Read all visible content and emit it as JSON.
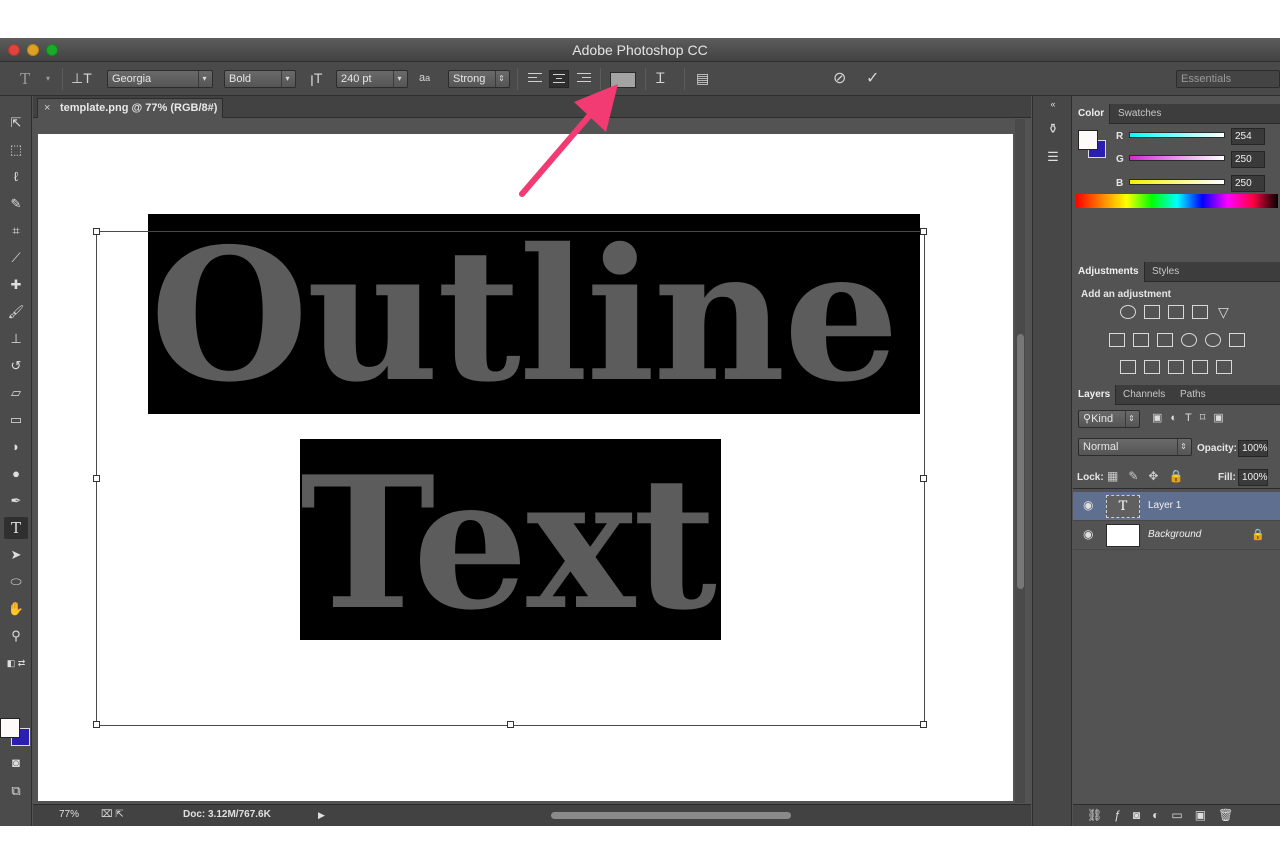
{
  "window": {
    "title": "Adobe Photoshop CC"
  },
  "options_bar": {
    "font_family": "Georgia",
    "font_style": "Bold",
    "font_size": "240 pt",
    "antialias_icon_text": "a",
    "antialias_icon_text2": "a",
    "antialias": "Strong",
    "text_color": "#a3a3a3",
    "workspace": "Essentials"
  },
  "document": {
    "tab_title": "template.png @ 77% (RGB/8#)",
    "tab_close": "×",
    "canvas_text_line1": "Outline",
    "canvas_text_line2": "Text"
  },
  "status_bar": {
    "zoom": "77%",
    "doc_info": "Doc: 3.12M/767.6K"
  },
  "color_panel": {
    "tabs": [
      "Color",
      "Swatches"
    ],
    "channels": [
      {
        "label": "R",
        "value": "254"
      },
      {
        "label": "G",
        "value": "250"
      },
      {
        "label": "B",
        "value": "250"
      }
    ],
    "foreground": "#fefafa",
    "background": "#2a1fb0"
  },
  "adjustments_panel": {
    "tabs": [
      "Adjustments",
      "Styles"
    ],
    "heading": "Add an adjustment"
  },
  "layers_panel": {
    "tabs": [
      "Layers",
      "Channels",
      "Paths"
    ],
    "filter": "Kind",
    "blend_mode": "Normal",
    "opacity_label": "Opacity:",
    "opacity": "100%",
    "lock_label": "Lock:",
    "fill_label": "Fill:",
    "fill": "100%",
    "layers": [
      {
        "name": "Layer 1",
        "type": "text",
        "thumb_glyph": "T"
      },
      {
        "name": "Background",
        "type": "image"
      }
    ]
  },
  "colors": {
    "selected_layer": "#5f6f8f",
    "arrow": "#f23a73"
  }
}
